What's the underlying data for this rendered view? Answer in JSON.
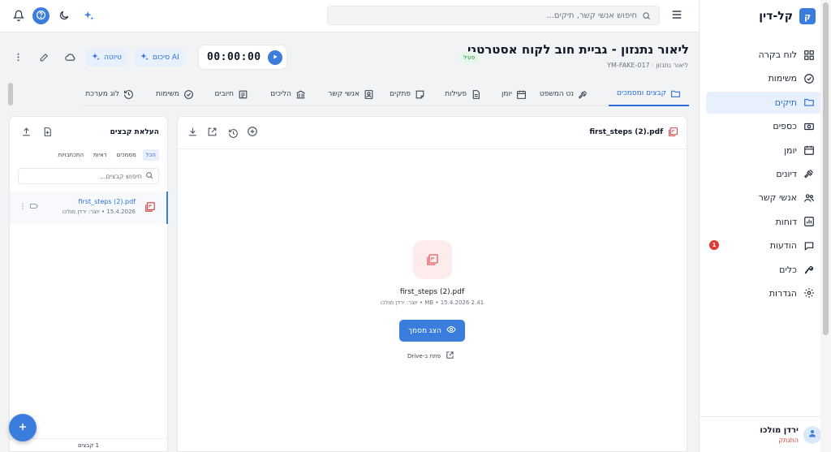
{
  "app": {
    "name": "קל-דין",
    "logo_letter": "ק"
  },
  "sidebar": {
    "items": [
      {
        "label": "לוח בקרה",
        "icon": "dashboard-icon"
      },
      {
        "label": "משימות",
        "icon": "check-circle-icon"
      },
      {
        "label": "תיקים",
        "icon": "folder-icon",
        "active": true
      },
      {
        "label": "כספים",
        "icon": "money-icon"
      },
      {
        "label": "יומן",
        "icon": "calendar-icon"
      },
      {
        "label": "דיונים",
        "icon": "gavel-icon"
      },
      {
        "label": "אנשי קשר",
        "icon": "people-icon"
      },
      {
        "label": "דוחות",
        "icon": "chart-icon"
      },
      {
        "label": "הודעות",
        "icon": "chat-icon",
        "badge": "1"
      },
      {
        "label": "כלים",
        "icon": "wrench-icon"
      },
      {
        "label": "הגדרות",
        "icon": "gear-icon"
      }
    ],
    "user": {
      "name": "ירדן מולכו",
      "logout": "התנתק"
    }
  },
  "topbar": {
    "search_placeholder": "חיפוש אנשי קשר, תיקים..."
  },
  "case": {
    "title": "ליאור נתנזון - גביית חוב לקוח אסטרטגי",
    "id": "YM-FAKE-017",
    "client": "ליאור נתנזון",
    "status": "פעיל",
    "timer": "00:00:00",
    "ai_summary_label": "סיכום AI",
    "draft_label": "טיוטה"
  },
  "tabs": [
    {
      "label": "קבצים ומסמכים",
      "icon": "folder-icon",
      "active": true
    },
    {
      "label": "נט המשפט",
      "icon": "gavel-icon"
    },
    {
      "label": "יומן",
      "icon": "calendar-icon"
    },
    {
      "label": "פעילות",
      "icon": "document-icon"
    },
    {
      "label": "פתקים",
      "icon": "note-icon"
    },
    {
      "label": "אנשי קשר",
      "icon": "contact-card-icon"
    },
    {
      "label": "הליכים",
      "icon": "court-icon"
    },
    {
      "label": "חיובים",
      "icon": "invoice-icon"
    },
    {
      "label": "משימות",
      "icon": "check-circle-icon"
    },
    {
      "label": "לוג מערכת",
      "icon": "history-icon"
    }
  ],
  "viewer": {
    "file_name": "first_steps (2).pdf",
    "file_meta": "2.41 MB • 15.4.2026 • יוצר: ירדן מולכו",
    "show_doc_label": "הצג מסמך",
    "open_drive_label": "פתח ב-Drive"
  },
  "files_panel": {
    "title": "העלאת קבצים",
    "filters": [
      "הכל",
      "מסמכים",
      "ראיות",
      "התכתבויות"
    ],
    "search_placeholder": "חיפוש קבצים...",
    "files": [
      {
        "name": "first_steps (2).pdf",
        "meta": "15.4.2026 • יוצר: ירדן מולכו"
      }
    ],
    "count": "1 קבצים"
  },
  "colors": {
    "primary": "#3b7ddd",
    "danger": "#e03a3a",
    "success": "#1f8a3e"
  }
}
